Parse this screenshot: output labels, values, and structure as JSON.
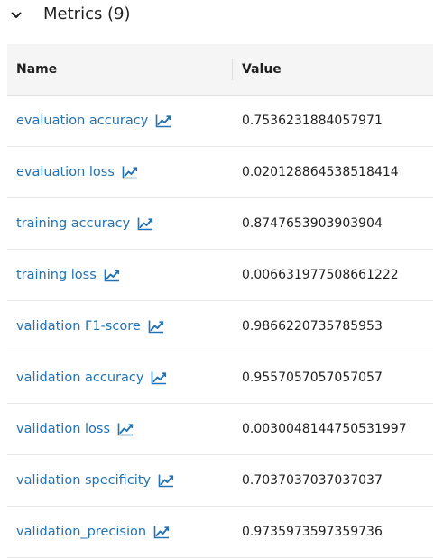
{
  "section": {
    "title": "Metrics (9)",
    "expanded": true
  },
  "table": {
    "columns": {
      "name": "Name",
      "value": "Value"
    },
    "rows": [
      {
        "name": "evaluation accuracy",
        "value": "0.7536231884057971"
      },
      {
        "name": "evaluation loss",
        "value": "0.020128864538518414"
      },
      {
        "name": "training accuracy",
        "value": "0.8747653903903904"
      },
      {
        "name": "training loss",
        "value": "0.006631977508661222"
      },
      {
        "name": "validation F1-score",
        "value": "0.9866220735785953"
      },
      {
        "name": "validation accuracy",
        "value": "0.9557057057057057"
      },
      {
        "name": "validation loss",
        "value": "0.0030048144750531997"
      },
      {
        "name": "validation specificity",
        "value": "0.7037037037037037"
      },
      {
        "name": "validation_precision",
        "value": "0.9735973597359736"
      }
    ]
  },
  "icons": {
    "collapse": "chevron-down-icon",
    "chart": "line-chart-icon"
  },
  "colors": {
    "link": "#2272b4",
    "header_bg": "#f5f5f5",
    "text": "#1f1f1f"
  }
}
